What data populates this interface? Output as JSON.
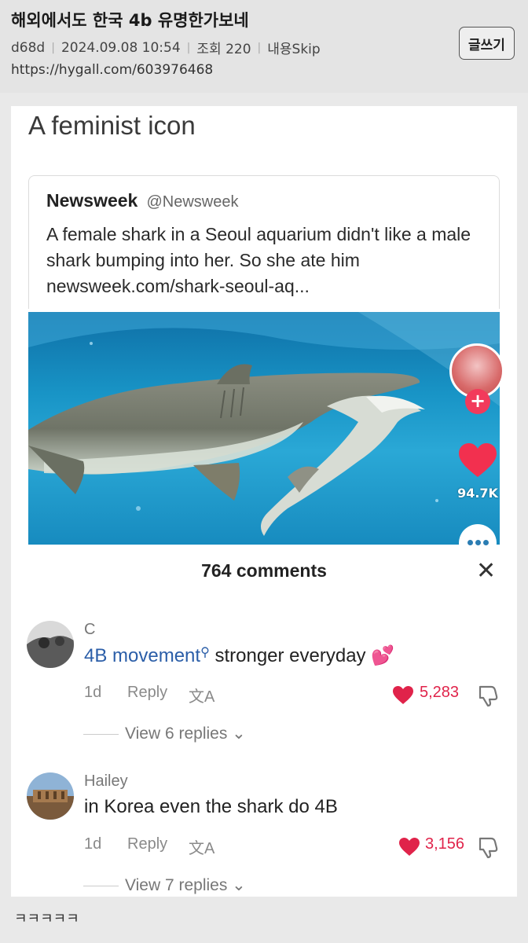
{
  "header": {
    "title": "해외에서도 한국 4b 유명한가보네",
    "author": "d68d",
    "datetime": "2024.09.08 10:54",
    "views": "조회 220",
    "skip": "내용Skip",
    "url": "https://hygall.com/603976468",
    "write_button": "글쓰기"
  },
  "post": {
    "caption": "A feminist icon",
    "tweet": {
      "name": "Newsweek",
      "handle": "@Newsweek",
      "text": "A female shark in a Seoul aquarium didn't like a male shark bumping into her. So she ate him newsweek.com/shark-seoul-aq..."
    },
    "video_side": {
      "likes": "94.7K",
      "plus": "+"
    },
    "comments_header": "764 comments",
    "close": "✕",
    "comments": [
      {
        "user": "C",
        "link_text": "4B movement",
        "search_mark": "⚲",
        "text": " stronger everyday 💕",
        "age": "1d",
        "reply": "Reply",
        "translate": "文A",
        "likes": "5,283",
        "view_replies": "View 6 replies ⌄"
      },
      {
        "user": "Hailey",
        "text": "in Korea even the shark do 4B",
        "age": "1d",
        "reply": "Reply",
        "translate": "文A",
        "likes": "3,156",
        "view_replies": "View 7 replies ⌄"
      }
    ]
  },
  "footer": {
    "text": "ㅋㅋㅋㅋㅋ"
  },
  "colors": {
    "like_red": "#e0234a",
    "link_blue": "#2b5ea8",
    "water": "#1894c6"
  },
  "icons": [
    "heart-icon",
    "dislike-icon",
    "close-icon",
    "translate-icon",
    "plus-icon",
    "more-icon",
    "chevron-down-icon"
  ]
}
